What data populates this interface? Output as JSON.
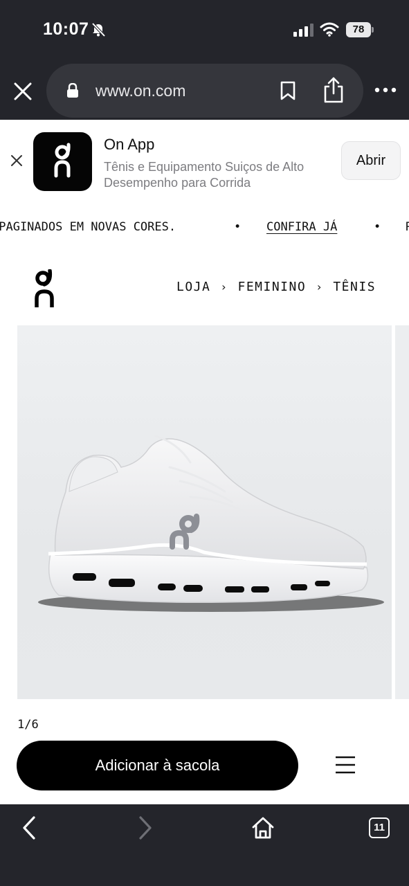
{
  "status_bar": {
    "time": "10:07",
    "battery": "78"
  },
  "browser": {
    "url": "www.on.com",
    "tab_count": "11",
    "icons": [
      "close-icon",
      "lock-icon",
      "bookmark-icon",
      "share-icon",
      "more-icon",
      "back-icon",
      "forward-icon",
      "home-icon"
    ]
  },
  "app_banner": {
    "name": "On App",
    "description": "Tênis e Equipamento Suiços de Alto Desempenho para Corrida",
    "open_label": "Abrir"
  },
  "ticker": {
    "text": "EPAGINADOS EM NOVAS CORES.",
    "separator": "•",
    "link": "CONFIRA JÁ",
    "trailing": "R"
  },
  "breadcrumb": {
    "items": [
      "LOJA",
      "FEMININO",
      "TÊNIS"
    ],
    "separator": "›"
  },
  "product": {
    "image_counter": "1/6"
  },
  "buy_bar": {
    "add_to_bag_label": "Adicionar à sacola"
  },
  "colors": {
    "browser_chrome": "#24252b",
    "url_bar": "#35363c",
    "primary_button": "#000000",
    "image_background": "#eceef0"
  }
}
